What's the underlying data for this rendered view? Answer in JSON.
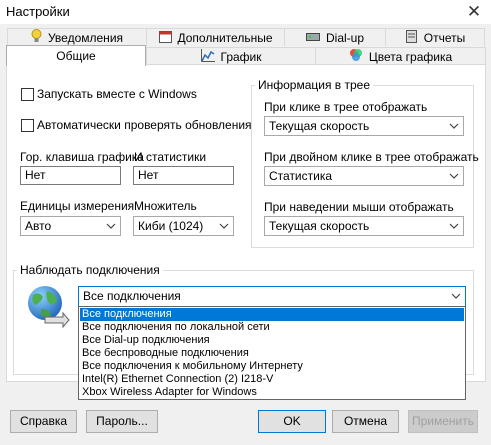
{
  "window": {
    "title": "Настройки",
    "close_glyph": "✕"
  },
  "tabs": {
    "row_back": [
      {
        "label": "Уведомления",
        "icon": "bulb-icon"
      },
      {
        "label": "Дополнительные",
        "icon": "calendar-icon"
      },
      {
        "label": "Dial-up",
        "icon": "modem-icon"
      },
      {
        "label": "Отчеты",
        "icon": "report-icon"
      }
    ],
    "row_front": [
      {
        "label": "Общие",
        "icon": "",
        "active": true
      },
      {
        "label": "График",
        "icon": "chart-icon"
      },
      {
        "label": "Цвета графика",
        "icon": "palette-icon"
      }
    ]
  },
  "general": {
    "autostart_label": "Запускать вместе с Windows",
    "autostart_checked": false,
    "autoupdate_label": "Автоматически проверять обновления",
    "autoupdate_checked": false,
    "hotkey_graph_label": "Гор. клавиша графика",
    "hotkey_stats_label": "И статистики",
    "hotkey_graph_value": "Нет",
    "hotkey_stats_value": "Нет",
    "units_label": "Единицы измерения",
    "units_value": "Авто",
    "multiplier_label": "Множитель",
    "multiplier_value": "Киби (1024)"
  },
  "tray": {
    "group_title": "Информация в трее",
    "click_label": "При клике в трее отображать",
    "click_value": "Текущая скорость",
    "dblclick_label": "При двойном клике в трее отображать",
    "dblclick_value": "Статистика",
    "hover_label": "При наведении мыши отображать",
    "hover_value": "Текущая скорость"
  },
  "connections": {
    "group_title": "Наблюдать подключения",
    "selected_value": "Все подключения",
    "options": [
      "Все подключения",
      "Все подключения по локальной сети",
      "Все Dial-up подключения",
      "Все беспроводные подключения",
      "Все подключения к мобильному Интернету",
      "Intel(R) Ethernet Connection (2) I218-V",
      "Xbox Wireless Adapter for Windows"
    ],
    "highlighted_index": 0
  },
  "buttons": {
    "help": "Справка",
    "password": "Пароль...",
    "ok": "OK",
    "cancel": "Отмена",
    "apply": "Применить"
  },
  "colors": {
    "accent": "#0078d7",
    "window_bg": "#f0f0f0",
    "panel_bg": "#ffffff"
  }
}
